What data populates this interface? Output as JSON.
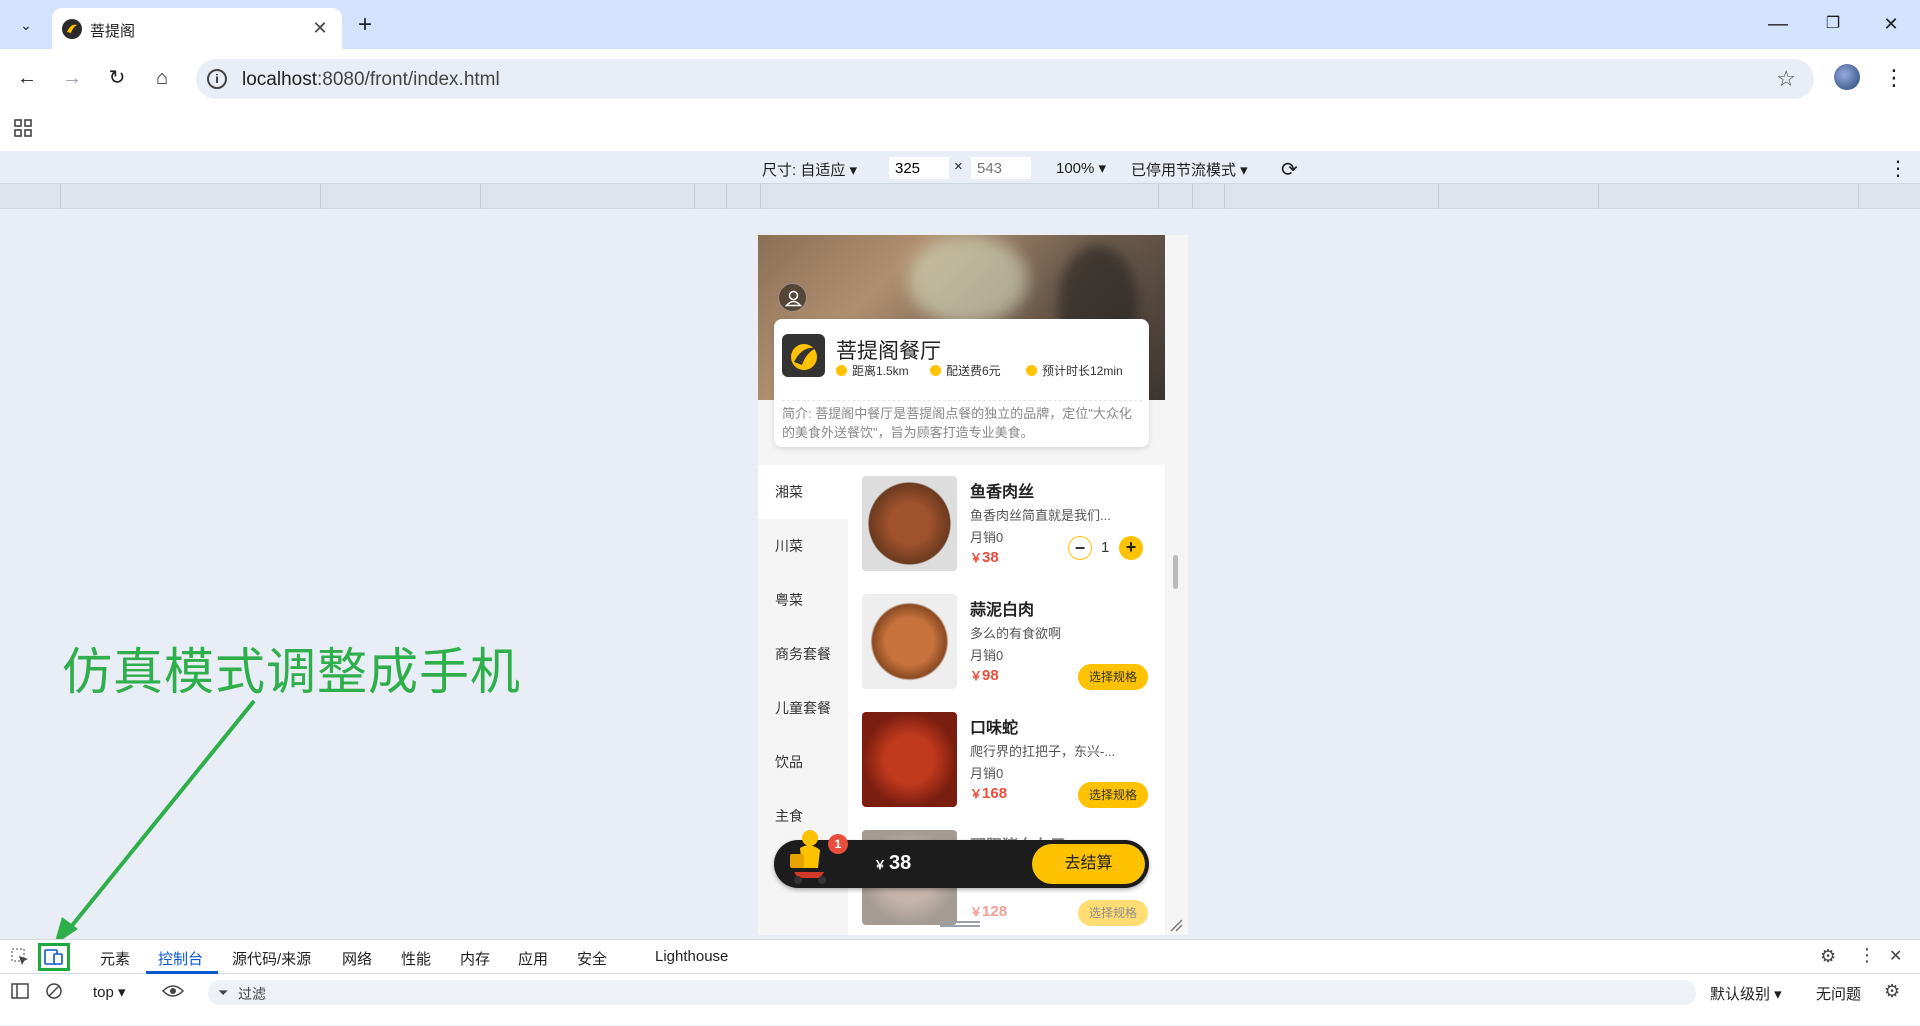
{
  "browser": {
    "tab_title": "菩提阁",
    "url_host": "localhost",
    "url_rest": ":8080/front/index.html",
    "tab_close": "✕",
    "new_tab": "+"
  },
  "device_toolbar": {
    "size_label": "尺寸: 自适应",
    "width_value": "325",
    "times": "×",
    "height_placeholder": "543",
    "zoom": "100%",
    "throttle": "已停用节流模式"
  },
  "app": {
    "restaurant_name": "菩提阁餐厅",
    "distance": "距离1.5km",
    "delivery_fee": "配送费6元",
    "eta": "预计时长12min",
    "intro": "简介: 菩提阁中餐厅是菩提阁点餐的独立的品牌，定位\"大众化的美食外送餐饮\"，旨为顾客打造专业美食。",
    "categories": [
      "湘菜",
      "川菜",
      "粤菜",
      "商务套餐",
      "儿童套餐",
      "饮品",
      "主食"
    ],
    "active_category": "湘菜",
    "dishes": [
      {
        "name": "鱼香肉丝",
        "desc": "鱼香肉丝简直就是我们...",
        "sold": "月销0",
        "price": "38",
        "qty": "1",
        "color": "#7a4a2a"
      },
      {
        "name": "蒜泥白肉",
        "desc": "多么的有食欲啊",
        "sold": "月销0",
        "price": "98",
        "spec": "选择规格",
        "color": "#b86a3c"
      },
      {
        "name": "口味蛇",
        "desc": "爬行界的扛把子，东兴-...",
        "sold": "月销0",
        "price": "168",
        "spec": "选择规格",
        "color": "#a8301c"
      },
      {
        "name": "邵阳猪血丸子",
        "desc": "",
        "sold": "",
        "price": "128",
        "spec": "选择规格",
        "color": "#8a6a5a"
      }
    ],
    "currency": "￥",
    "cart": {
      "count": "1",
      "total": "38",
      "checkout": "去结算"
    },
    "brand_color": "#ffc200",
    "price_color": "#e94e3c"
  },
  "annotation": {
    "text": "仿真模式调整成手机",
    "color": "#2fae4c"
  },
  "devtools": {
    "tabs": [
      "元素",
      "控制台",
      "源代码/来源",
      "网络",
      "性能",
      "内存",
      "应用",
      "安全",
      "Lighthouse"
    ],
    "active_tab": "控制台",
    "context": "top",
    "filter_placeholder": "过滤",
    "level": "默认级别",
    "issues": "无问题"
  }
}
